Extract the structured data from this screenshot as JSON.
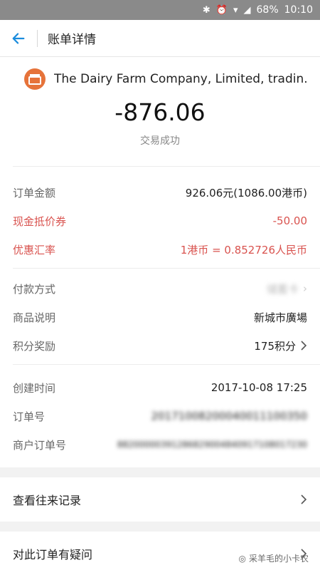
{
  "status_bar": {
    "battery": "68%",
    "time": "10:10"
  },
  "nav": {
    "title": "账单详情"
  },
  "merchant": {
    "name": "The Dairy Farm Company, Limited, tradin..."
  },
  "amount": "-876.06",
  "trade_status": "交易成功",
  "details": [
    {
      "label": "订单金额",
      "value": "926.06元(1086.00港币)"
    },
    {
      "label": "现金抵价券",
      "value": "-50.00"
    },
    {
      "label": "优惠汇率",
      "value": "1港币 = 0.852726人民币"
    }
  ],
  "payment": [
    {
      "label": "付款方式",
      "value": "储蓄卡"
    },
    {
      "label": "商品说明",
      "value": "新城市廣場"
    },
    {
      "label": "积分奖励",
      "value": "175积分"
    }
  ],
  "meta": [
    {
      "label": "创建时间",
      "value": "2017-10-08 17:25"
    },
    {
      "label": "订单号",
      "value": "20171008200040011100350"
    },
    {
      "label": "商户订单号",
      "value": "88200000391286829004840917108017230"
    }
  ],
  "actions": {
    "history": "查看往来记录",
    "question": "对此订单有疑问"
  },
  "watermark": "采羊毛的小卡农",
  "colors": {
    "accent": "#1a8cdd",
    "red": "#d9534f",
    "merchant_icon": "#e6733a"
  }
}
